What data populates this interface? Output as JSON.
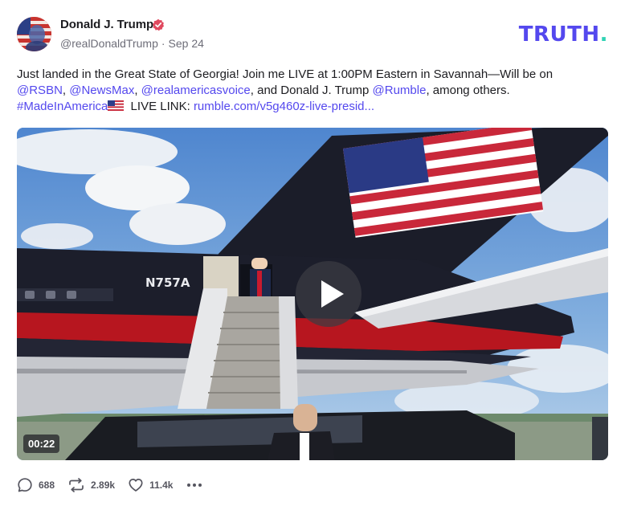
{
  "author": {
    "name": "Donald J. Trump",
    "handle": "@realDonaldTrump",
    "separator": "·",
    "date": "Sep 24",
    "avatar_icon": "flag-portrait-avatar",
    "verified_icon": "verified-badge-icon",
    "verified_color": "#e0495f"
  },
  "brand": {
    "word": "TRUTH",
    "period": ".",
    "color": "#5448ee",
    "accent": "#2fd3b4"
  },
  "post": {
    "text_1": "Just landed in the Great State of Georgia! Join me LIVE at 1:00PM Eastern in Savannah—Will be on ",
    "mention_1": "@RSBN",
    "sep_1": ", ",
    "mention_2": "@NewsMax",
    "sep_2": ", ",
    "mention_3": "@realamericasvoice",
    "text_2": ", and Donald J. Trump ",
    "mention_4": "@Rumble",
    "text_3": ", among others. ",
    "hashtag": "#MadeInAmerica",
    "flag_icon": "us-flag-emoji",
    "text_4": " LIVE LINK: ",
    "link": "rumble.com/v5g460z-live-presid...",
    "link_color": "#5448ee"
  },
  "media": {
    "type": "video",
    "duration": "00:22",
    "tail_number": "N757A",
    "play_icon": "play-icon"
  },
  "actions": {
    "replies": "688",
    "retruths": "2.89k",
    "likes": "11.4k",
    "reply_icon": "reply-icon",
    "retruth_icon": "retruth-icon",
    "like_icon": "heart-icon",
    "more_icon": "more-icon"
  }
}
